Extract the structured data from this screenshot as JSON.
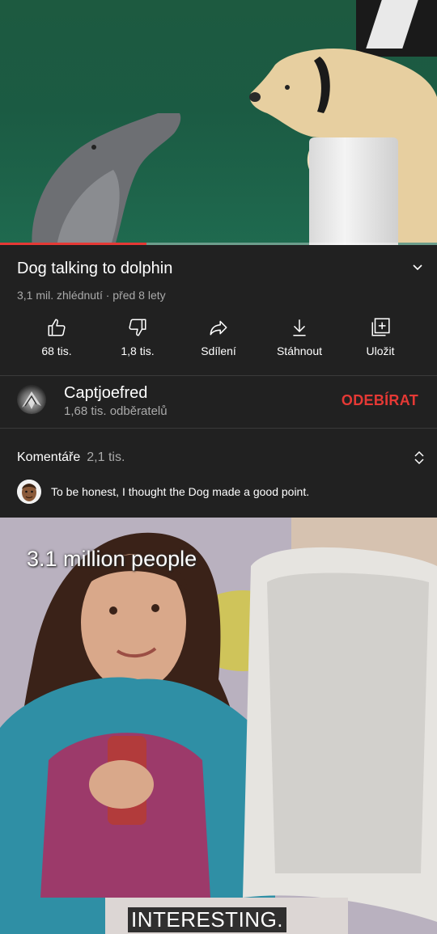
{
  "video": {
    "progress_fraction": 0.335
  },
  "info": {
    "title": "Dog talking to dolphin",
    "meta": "3,1 mil. zhlédnutí · před 8 lety"
  },
  "actions": [
    {
      "label": "68 tis.",
      "icon": "thumbs-up-icon"
    },
    {
      "label": "1,8 tis.",
      "icon": "thumbs-down-icon"
    },
    {
      "label": "Sdílení",
      "icon": "share-icon"
    },
    {
      "label": "Stáhnout",
      "icon": "download-icon"
    },
    {
      "label": "Uložit",
      "icon": "add-to-playlist-icon"
    }
  ],
  "channel": {
    "name": "Captjoefred",
    "subscribers": "1,68 tis. odběratelů",
    "subscribe_label": "ODEBÍRAT",
    "accent": "#e53935"
  },
  "comments": {
    "heading": "Komentáře",
    "count": "2,1 tis.",
    "top_comment": "To be honest, I thought the Dog made a good point."
  },
  "meme": {
    "top_text": "3.1 million people",
    "caption": "INTERESTING."
  }
}
